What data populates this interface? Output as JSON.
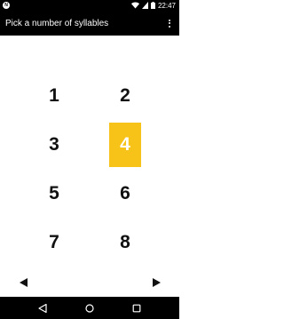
{
  "status_bar": {
    "app_icon_text": "N",
    "time": "22:47",
    "icons": [
      "notification-app-icon",
      "wifi-icon",
      "cell-signal-icon",
      "battery-icon"
    ]
  },
  "app_bar": {
    "title": "Pick a number of syllables",
    "menu_icon": "overflow-menu-icon"
  },
  "grid": {
    "selected": "4",
    "accent_color": "#f7c318",
    "numbers": [
      "1",
      "2",
      "3",
      "4",
      "5",
      "6",
      "7",
      "8"
    ]
  },
  "paging": {
    "prev_icon": "left-arrow-icon",
    "next_icon": "right-arrow-icon"
  },
  "nav_bar": {
    "icons": [
      "back-icon",
      "home-icon",
      "recents-icon"
    ]
  }
}
